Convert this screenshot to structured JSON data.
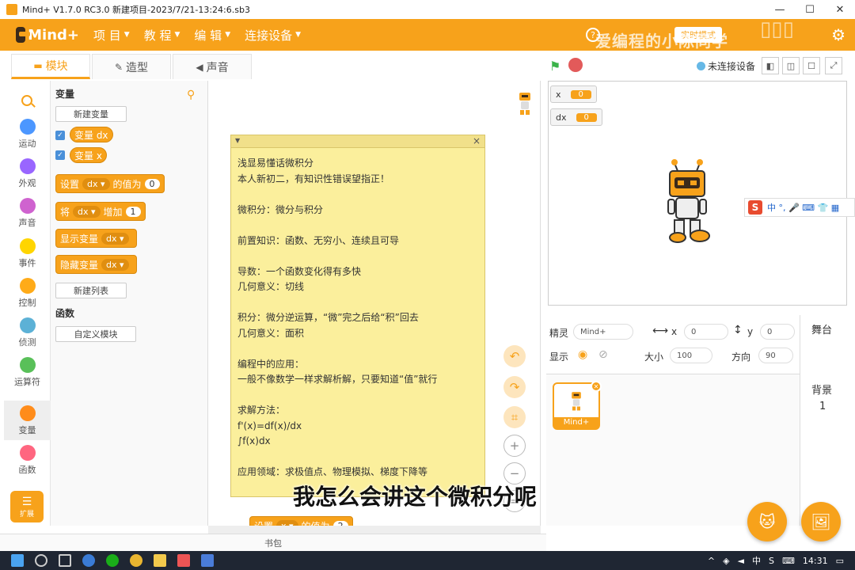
{
  "window": {
    "title": "Mind+ V1.7.0 RC3.0   新建项目-2023/7/21-13:24:6.sb3",
    "minimize": "—",
    "maximize": "☐",
    "close": "✕"
  },
  "menu": {
    "logo": "Mind+",
    "items": [
      "项 目",
      "教 程",
      "编 辑",
      "连接设备"
    ],
    "mode_button": "实时模式",
    "watermark": "爱编程的小陈同学",
    "gear_icon": "gear-icon"
  },
  "tabs": [
    "模块",
    "造型",
    "声音"
  ],
  "categories": [
    {
      "label": "运动",
      "color": "#4c97ff"
    },
    {
      "label": "外观",
      "color": "#9966ff"
    },
    {
      "label": "声音",
      "color": "#cf63cf"
    },
    {
      "label": "事件",
      "color": "#ffd500"
    },
    {
      "label": "控制",
      "color": "#ffab19"
    },
    {
      "label": "侦测",
      "color": "#5cb1d6"
    },
    {
      "label": "运算符",
      "color": "#59c059"
    },
    {
      "label": "变量",
      "color": "#ff8c1a"
    },
    {
      "label": "函数",
      "color": "#ff6680"
    }
  ],
  "extension_label": "扩展",
  "palette": {
    "variables_title": "变量",
    "new_variable": "新建变量",
    "var_dx": "变量 dx",
    "var_x": "变量 x",
    "set_label": "设置",
    "set_var": "dx ▾",
    "set_to": "的值为",
    "set_value": "0",
    "change_label": "将",
    "change_var": "dx ▾",
    "change_by": "增加",
    "change_value": "1",
    "show_var": "显示变量",
    "show_var_name": "dx ▾",
    "hide_var": "隐藏变量",
    "hide_var_name": "dx ▾",
    "new_list": "新建列表",
    "functions_title": "函数",
    "custom_block": "自定义模块"
  },
  "note": {
    "text": "浅显易懂话微积分\n本人新初二，有知识性错误望指正！\n\n微积分：微分与积分\n\n前置知识：函数、无穷小、连续且可导\n\n导数：一个函数变化得有多快\n几何意义：切线\n\n积分：微分逆运算，“微”完之后给“积”回去\n几何意义：面积\n\n编程中的应用：\n一般不像数学一样求解析解，只要知道“值”就行\n\n求解方法：\nf'(x)=df(x)/dx\n∫f(x)dx\n\n应用领域：求极值点、物理模拟、梯度下降等"
  },
  "script_bottom_block": {
    "label": "设置",
    "var": "x ▾",
    "to": "的值为",
    "value": "2"
  },
  "bag_label": "书包",
  "stage_controls": {
    "connection": "未连接设备"
  },
  "monitors": [
    {
      "name": "x",
      "value": "0"
    },
    {
      "name": "dx",
      "value": "0"
    }
  ],
  "ime": {
    "logo": "S",
    "text": "中 °, 🎤 ⌨ 👕 ▦"
  },
  "sprite_props": {
    "sprite_label": "精灵",
    "sprite_name": "Mind+",
    "x_label": "x",
    "x_value": "0",
    "y_label": "y",
    "y_value": "0",
    "show_label": "显示",
    "size_label": "大小",
    "size_value": "100",
    "direction_label": "方向",
    "direction_value": "90"
  },
  "sprite_card_name": "Mind+",
  "stage_pane": {
    "title": "舞台",
    "backdrop_label": "背景",
    "backdrop_count": "1"
  },
  "subtitle": "我怎么会讲这个微积分呢",
  "taskbar": {
    "ime_mode": "中",
    "time": "14:31"
  }
}
